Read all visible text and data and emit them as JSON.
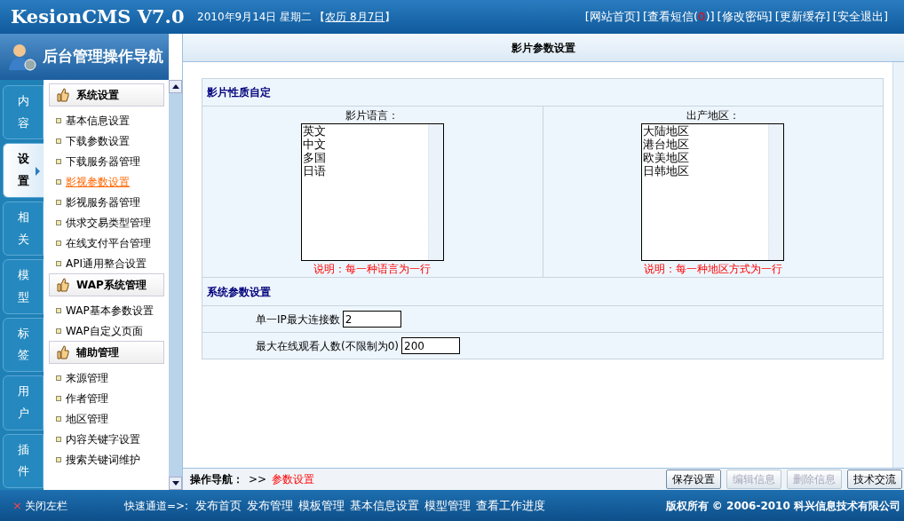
{
  "header": {
    "logo": "KesionCMS V7.0",
    "date": "2010年9月14日 星期二",
    "lunar_open": "【",
    "lunar": "农历 8月7日",
    "lunar_close": "】",
    "links": [
      {
        "text": "[网站首页]"
      },
      {
        "text": "[查看短信(",
        "count": "0",
        "after": ")]"
      },
      {
        "text": "[修改密码]"
      },
      {
        "text": "[更新缓存]"
      },
      {
        "text": "[安全退出]"
      }
    ]
  },
  "sidebar": {
    "banner": "后台管理操作导航",
    "tabs": [
      {
        "label": "内容",
        "selected": false
      },
      {
        "label": "设置",
        "selected": true
      },
      {
        "label": "相关",
        "selected": false
      },
      {
        "label": "模型",
        "selected": false
      },
      {
        "label": "标签",
        "selected": false
      },
      {
        "label": "用户",
        "selected": false
      },
      {
        "label": "插件",
        "selected": false
      }
    ],
    "groups": [
      {
        "title": "系统设置",
        "items": [
          {
            "label": "基本信息设置",
            "selected": false
          },
          {
            "label": "下载参数设置",
            "selected": false
          },
          {
            "label": "下载服务器管理",
            "selected": false
          },
          {
            "label": "影视参数设置",
            "selected": true
          },
          {
            "label": "影视服务器管理",
            "selected": false
          },
          {
            "label": "供求交易类型管理",
            "selected": false
          },
          {
            "label": "在线支付平台管理",
            "selected": false
          },
          {
            "label": "API通用整合设置",
            "selected": false
          }
        ]
      },
      {
        "title": "WAP系统管理",
        "items": [
          {
            "label": "WAP基本参数设置",
            "selected": false
          },
          {
            "label": "WAP自定义页面",
            "selected": false
          }
        ]
      },
      {
        "title": "辅助管理",
        "items": [
          {
            "label": "来源管理",
            "selected": false
          },
          {
            "label": "作者管理",
            "selected": false
          },
          {
            "label": "地区管理",
            "selected": false
          },
          {
            "label": "内容关键字设置",
            "selected": false
          },
          {
            "label": "搜索关键词维护",
            "selected": false
          }
        ]
      }
    ]
  },
  "main": {
    "title": "影片参数设置",
    "section_1": {
      "title": "影片性质自定",
      "lists": [
        {
          "label": "影片语言：",
          "options": [
            "英文",
            "中文",
            "多国",
            "日语"
          ],
          "note": "说明：每一种语言为一行"
        },
        {
          "label": "出产地区：",
          "options": [
            "大陆地区",
            "港台地区",
            "欧美地区",
            "日韩地区"
          ],
          "note": "说明：每一种地区方式为一行"
        }
      ]
    },
    "section_2": {
      "title": "系统参数设置",
      "fields": [
        {
          "label": "单一IP最大连接数",
          "value": "2"
        },
        {
          "label": "最大在线观看人数(不限制为0)",
          "value": "200"
        }
      ]
    },
    "ops": {
      "label": "操作导航：",
      "separator": ">>",
      "current": "参数设置",
      "buttons": [
        {
          "label": "保存设置",
          "disabled": false
        },
        {
          "label": "编辑信息",
          "disabled": true
        },
        {
          "label": "删除信息",
          "disabled": true
        },
        {
          "label": "技术交流",
          "disabled": false
        }
      ]
    }
  },
  "footer": {
    "close_icon": "×",
    "close": "关闭左栏",
    "quick": "快速通道=>:",
    "links": [
      "发布首页",
      "发布管理",
      "模板管理",
      "基本信息设置",
      "模型管理",
      "查看工作进度"
    ],
    "copyright": "版权所有 © 2006-2010 科兴信息技术有限公司"
  }
}
